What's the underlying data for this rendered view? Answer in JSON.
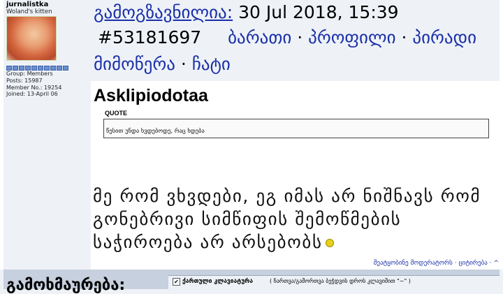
{
  "author": {
    "name": "jurnalistka",
    "title": "Woland's kitten",
    "avatar_icon": "avatar-portrait",
    "rank_pips": 10,
    "group": "Group: Members",
    "posts": "Posts: 15987",
    "member_no": "Member No.: 19254",
    "joined": "Joined: 13-April 06"
  },
  "header": {
    "posted_label": "გამოგზავნილია:",
    "date": "30 Jul 2018, 15:39",
    "post_id": "#53181697",
    "links": [
      "ბარათი",
      "პროფილი",
      "პირადი მიმოწერა",
      "ჩატი"
    ],
    "separator": "·"
  },
  "post": {
    "title": "Asklipiodotaa",
    "quote_label": "QUOTE",
    "quote_text": "წესით უნდა ხვდებოდე, რაც ხდება",
    "body": "მე რომ ვხვდები, ეგ იმას არ ნიშნავს რომ გონებრივი სიმწიფის შემოწმების საჭიროება არ არსებობს",
    "smiley_icon": "smiley-icon"
  },
  "footer": {
    "notify_moderators": "შეატყობინე მოდერატორს",
    "quote": "ციტირება",
    "sep": "·",
    "up_arrow": "^"
  },
  "reply": {
    "label": "გამოხმაურება:",
    "kb_label": "ქართული კლავიატურა",
    "kb_hint": "( ჩართვა/გამორთვა ბეჭდვის დროს კლავიშით \"~\" )",
    "kb_checked": true
  },
  "colors": {
    "link": "#1a2fa8",
    "sidebar_bg": "#eef2f7",
    "reply_bg": "#c6d0de"
  }
}
